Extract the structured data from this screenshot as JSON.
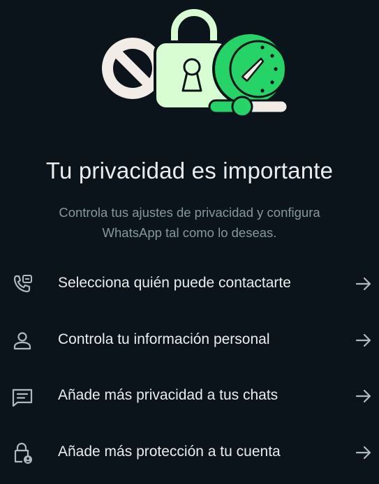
{
  "header": {
    "title": "Tu privacidad es importante",
    "subtitle": "Controla tus ajustes de privacidad y configura WhatsApp tal como lo deseas."
  },
  "hero": {
    "icon": "privacy-illustration-icon",
    "colors": {
      "block_white": "#f1ece6",
      "lock_green": "#d9fdd3",
      "gauge_green": "#25d366",
      "outline": "#0b141a"
    }
  },
  "options": [
    {
      "label": "Selecciona quién puede contactarte",
      "icon": "phone-contact-icon"
    },
    {
      "label": "Controla tu información personal",
      "icon": "person-icon"
    },
    {
      "label": "Añade más privacidad a tus chats",
      "icon": "chat-icon"
    },
    {
      "label": "Añade más protección a tu cuenta",
      "icon": "lock-account-icon"
    }
  ],
  "colors": {
    "background": "#0b141a",
    "text_primary": "#e9edef",
    "text_secondary": "#8696a0",
    "icon": "#aebac1"
  }
}
